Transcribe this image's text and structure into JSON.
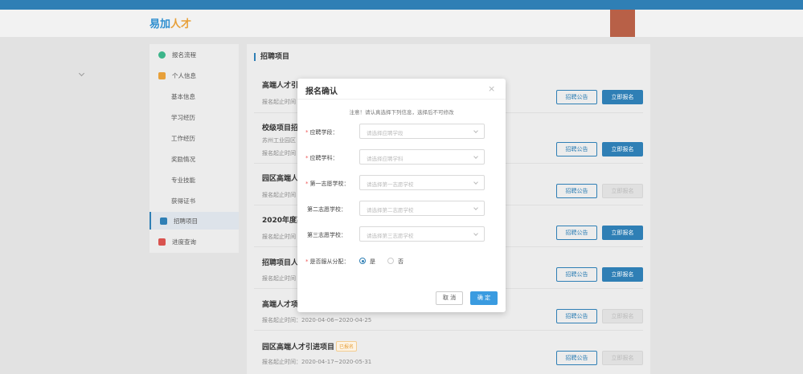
{
  "header": {
    "logo_part1": "易加",
    "logo_part2": "人才"
  },
  "sidebar": {
    "items": [
      {
        "label": "报名流程"
      },
      {
        "label": "个人信息"
      },
      {
        "label": "基本信息"
      },
      {
        "label": "学习经历"
      },
      {
        "label": "工作经历"
      },
      {
        "label": "奖励情况"
      },
      {
        "label": "专业技能"
      },
      {
        "label": "获得证书"
      },
      {
        "label": "招聘项目"
      },
      {
        "label": "进度查询"
      }
    ]
  },
  "main": {
    "title": "招聘项目",
    "projects": [
      {
        "title": "高端人才引",
        "sub": "报名起止时间"
      },
      {
        "title": "校级项目招",
        "sub2": "苏州工业园区",
        "sub": "报名起止时间"
      },
      {
        "title": "园区高端人",
        "sub": "报名起止时间"
      },
      {
        "title": "2020年度高",
        "sub": "报名起止时间"
      },
      {
        "title": "招聘项目人",
        "sub": "报名起止时间"
      },
      {
        "title": "高端人才项",
        "sub": "报名起止时间：2020-04-06~2020-04-25"
      },
      {
        "title": "园区高端人才引进项目",
        "badge": "已报名",
        "sub": "报名起止时间：2020-04-17~2020-05-31"
      }
    ],
    "notice_label": "招聘公告",
    "apply_label": "立即报名"
  },
  "modal": {
    "title": "报名确认",
    "close": "×",
    "note": "注意！请认真选择下列信息，选择后不可修改",
    "fields": [
      {
        "label": "应聘学段：",
        "required": "*",
        "placeholder": "请选择应聘学段"
      },
      {
        "label": "应聘学科：",
        "required": "*",
        "placeholder": "请选择应聘学科"
      },
      {
        "label": "第一志愿学校：",
        "required": "*",
        "placeholder": "请选择第一志愿学校"
      },
      {
        "label": "第二志愿学校：",
        "required": "",
        "placeholder": "请选择第二志愿学校"
      },
      {
        "label": "第三志愿学校：",
        "required": "",
        "placeholder": "请选择第三志愿学校"
      }
    ],
    "obey": {
      "required": "*",
      "label": "是否服从分配：",
      "yes": "是",
      "no": "否",
      "selected": "是"
    },
    "cancel": "取 消",
    "ok": "确 定"
  },
  "colors": {
    "primary": "#2f7fb5",
    "ok_button": "#3a9be0",
    "badge": "#e7a03a"
  }
}
